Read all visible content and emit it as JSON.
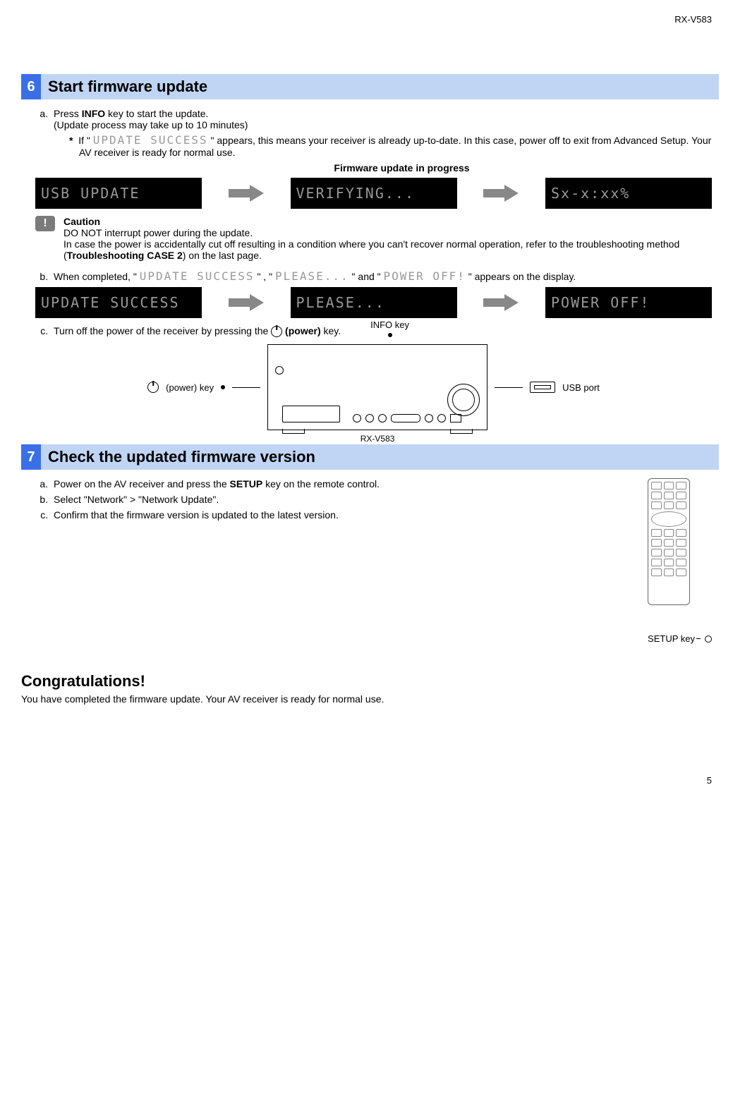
{
  "model": "RX-V583",
  "page_number": "5",
  "section6": {
    "number": "6",
    "title": "Start firmware update",
    "a_pre": "Press ",
    "a_bold": "INFO",
    "a_post": " key to start the update.",
    "a_sub": "(Update process may take up to 10 minutes)",
    "star_pre": "If \" ",
    "star_display": "UPDATE SUCCESS",
    "star_post": " \" appears, this means your receiver is already up-to-date. In this case, power off to exit from Advanced Setup. Your AV receiver is ready for normal use.",
    "progress_label": "Firmware update in progress",
    "display1": [
      "USB UPDATE",
      "VERIFYING...",
      "Sx-x:xx%"
    ],
    "caution_title": "Caution",
    "caution_line1": "DO NOT interrupt power during the update.",
    "caution_line2_pre": "In case the power is accidentally cut off resulting in a condition where you can't recover normal operation, refer to the troubleshooting method (",
    "caution_line2_bold": "Troubleshooting CASE 2",
    "caution_line2_post": ") on the last page.",
    "b_pre": "When completed, \" ",
    "b_d1": "UPDATE SUCCESS",
    "b_mid1": " \" , \" ",
    "b_d2": "PLEASE...",
    "b_mid2": " \" and \" ",
    "b_d3": "POWER OFF!",
    "b_post": " \" appears on the display.",
    "display2": [
      "UPDATE SUCCESS",
      "PLEASE...",
      "POWER OFF!"
    ],
    "c_pre": "Turn off the power of the receiver by pressing the ",
    "c_bold": " (power)",
    "c_post": " key.",
    "diagram": {
      "power_key": " (power) key",
      "info_key": "INFO key",
      "usb_port": "USB port",
      "model": "RX-V583"
    }
  },
  "section7": {
    "number": "7",
    "title": "Check the updated firmware version",
    "a_pre": "Power on the AV receiver and press the ",
    "a_bold": "SETUP",
    "a_post": " key on the remote control.",
    "b": "Select \"Network\" > \"Network Update\".",
    "c": "Confirm that the firmware version is updated to the latest version.",
    "setup_key": "SETUP key"
  },
  "congrats": {
    "title": "Congratulations!",
    "text": "You have completed the firmware update. Your AV receiver is ready for normal use."
  }
}
